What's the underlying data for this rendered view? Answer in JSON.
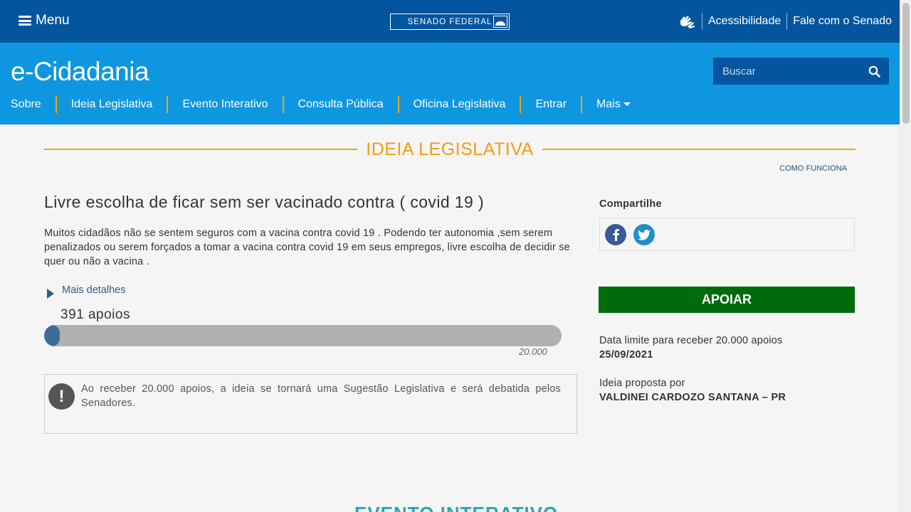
{
  "topbar": {
    "menu_label": "Menu",
    "logo_text": "SENADO FEDERAL",
    "accessibility_label": "Acessibilidade",
    "contact_label": "Fale com o Senado"
  },
  "header": {
    "brand": "e-Cidadania",
    "search_placeholder": "Buscar",
    "nav": [
      "Sobre",
      "Ideia Legislativa",
      "Evento Interativo",
      "Consulta Pública",
      "Oficina Legislativa",
      "Entrar",
      "Mais"
    ]
  },
  "section": {
    "title": "IDEIA LEGISLATIVA",
    "how_it_works": "COMO FUNCIONA"
  },
  "idea": {
    "title": "Livre escolha de ficar sem ser vacinado contra ( covid 19 )",
    "description": "Muitos cidadãos não se sentem seguros com a vacina contra covid 19 . Podendo ter autonomia ,sem serem penalizados ou serem forçados a tomar a vacina contra covid 19 em seus empregos, livre escolha de decidir se quer ou não a vacina .",
    "details_label": "Mais detalhes",
    "supports_text": "391 apoios",
    "supports_count": 391,
    "goal_count": 20000,
    "goal_label": "20.000",
    "notice": "Ao receber 20.000 apoios, a ideia se tornará uma Sugestão Legislativa e será debatida pelos Senadores."
  },
  "sidebar": {
    "share_label": "Compartilhe",
    "support_button": "APOIAR",
    "deadline_label": "Data limite para receber 20.000 apoios",
    "deadline_value": "25/09/2021",
    "proposer_label": "Ideia proposta por",
    "proposer_value": "VALDINEI CARDOZO SANTANA – PR"
  },
  "next_section_title": "EVENTO INTERATIVO",
  "colors": {
    "topbar": "#03559e",
    "header": "#0e97e0",
    "accent": "#f39c12",
    "support_button": "#006b0b",
    "progress_fill": "#3d6c97"
  }
}
